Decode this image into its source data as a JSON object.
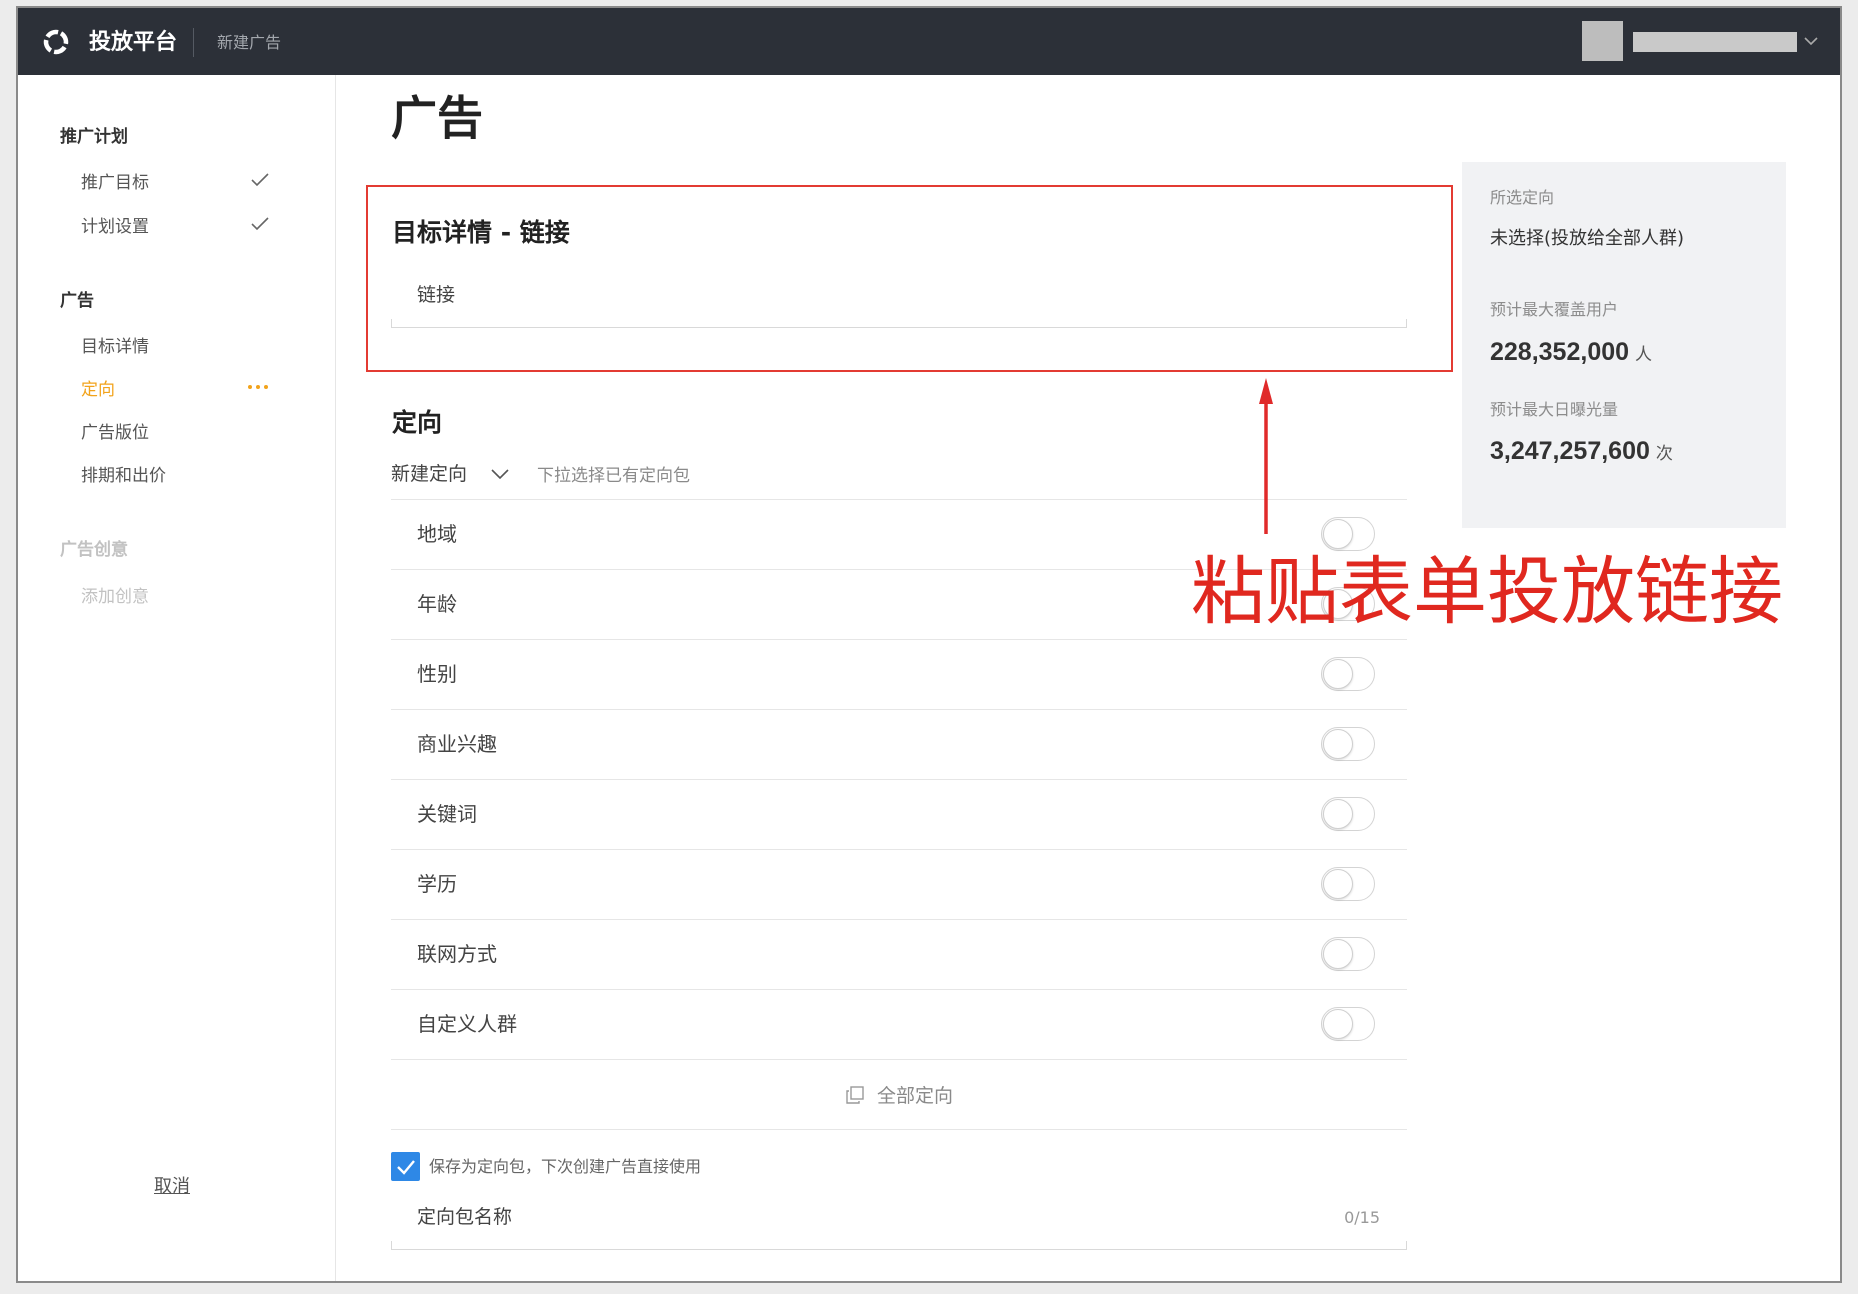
{
  "topbar": {
    "app_name": "投放平台",
    "breadcrumb": "新建广告",
    "logo_icon": "loop-logo-icon",
    "account_menu_icon": "chevron-down-icon"
  },
  "sidebar": {
    "sections": [
      {
        "title": "推广计划",
        "items": [
          {
            "label": "推广目标",
            "completed": true,
            "icon": "check-icon"
          },
          {
            "label": "计划设置",
            "completed": true,
            "icon": "check-icon"
          }
        ]
      },
      {
        "title": "广告",
        "items": [
          {
            "label": "目标详情",
            "completed": false
          },
          {
            "label": "定向",
            "active": true,
            "icon": "more-dots-icon"
          },
          {
            "label": "广告版位",
            "completed": false
          },
          {
            "label": "排期和出价",
            "completed": false
          }
        ]
      },
      {
        "title": "广告创意",
        "disabled": true,
        "items": [
          {
            "label": "添加创意",
            "disabled": true
          }
        ]
      }
    ],
    "cancel_label": "取消"
  },
  "main": {
    "page_title": "广告",
    "target_details": {
      "title": "目标详情 - 链接",
      "link_label": "链接",
      "link_value": ""
    },
    "targeting": {
      "title": "定向",
      "new_targeting_label": "新建定向",
      "package_select_hint": "下拉选择已有定向包",
      "options": [
        {
          "label": "地域",
          "enabled": false
        },
        {
          "label": "年龄",
          "enabled": false
        },
        {
          "label": "性别",
          "enabled": false
        },
        {
          "label": "商业兴趣",
          "enabled": false
        },
        {
          "label": "关键词",
          "enabled": false
        },
        {
          "label": "学历",
          "enabled": false
        },
        {
          "label": "联网方式",
          "enabled": false
        },
        {
          "label": "自定义人群",
          "enabled": false
        }
      ],
      "all_targeting_label": "全部定向",
      "all_targeting_icon": "copy-icon",
      "save_as_package": {
        "label": "保存为定向包，下次创建广告直接使用",
        "checked": true
      },
      "package_name": {
        "label": "定向包名称",
        "value": "",
        "counter": "0/15"
      }
    }
  },
  "summary_panel": {
    "selected_targeting_label": "所选定向",
    "selected_targeting_value": "未选择(投放给全部人群)",
    "max_reach_label": "预计最大覆盖用户",
    "max_reach_value": "228,352,000",
    "max_reach_unit": "人",
    "max_daily_impressions_label": "预计最大日曝光量",
    "max_daily_impressions_value": "3,247,257,600",
    "max_daily_impressions_unit": "次"
  },
  "annotation": {
    "text": "粘贴表单投放链接"
  },
  "colors": {
    "topbar_bg": "#2c3038",
    "accent_orange": "#f2a31b",
    "checkbox_blue": "#2e88e6",
    "highlight_red": "#e33b32",
    "annotation_red": "#e0281f"
  }
}
